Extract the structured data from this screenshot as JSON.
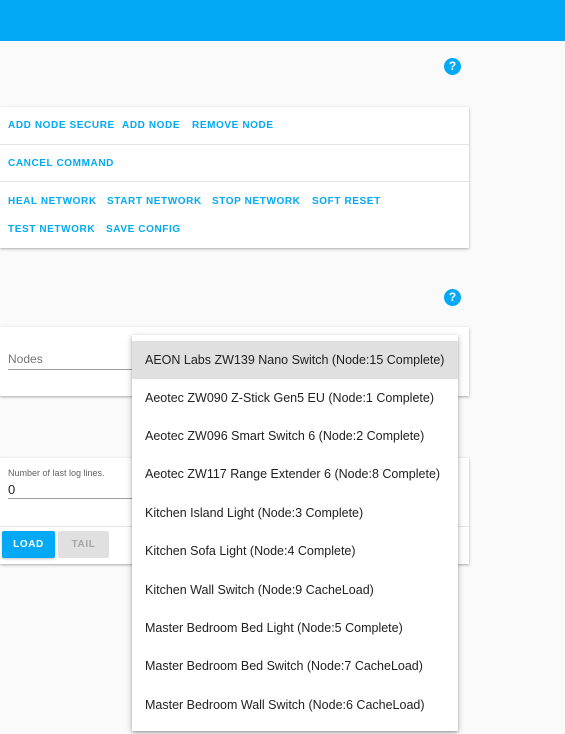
{
  "network_card": {
    "help_icon": "help-circle-icon",
    "row1": [
      "ADD NODE SECURE",
      "ADD NODE",
      "REMOVE NODE"
    ],
    "row2": [
      "CANCEL COMMAND"
    ],
    "row3": [
      "HEAL NETWORK",
      "START NETWORK",
      "STOP NETWORK",
      "SOFT RESET"
    ],
    "row4": [
      "TEST NETWORK",
      "SAVE CONFIG"
    ]
  },
  "nodes_card": {
    "help_icon": "help-circle-icon",
    "label": "Nodes"
  },
  "log_card": {
    "label": "Number of last log lines.",
    "value": "0",
    "load_label": "LOAD",
    "tail_label": "TAIL"
  },
  "nodes_dropdown": {
    "items": [
      "AEON Labs ZW139 Nano Switch (Node:15 Complete)",
      "Aeotec ZW090 Z-Stick Gen5 EU (Node:1 Complete)",
      "Aeotec ZW096 Smart Switch 6 (Node:2 Complete)",
      "Aeotec ZW117 Range Extender 6 (Node:8 Complete)",
      "Kitchen Island Light (Node:3 Complete)",
      "Kitchen Sofa Light (Node:4 Complete)",
      "Kitchen Wall Switch (Node:9 CacheLoad)",
      "Master Bedroom Bed Light (Node:5 Complete)",
      "Master Bedroom Bed Switch (Node:7 CacheLoad)",
      "Master Bedroom Wall Switch (Node:6 CacheLoad)"
    ],
    "selected_index": 0
  },
  "colors": {
    "accent": "#03a9f4",
    "selected_item": "#e0e0e0"
  }
}
